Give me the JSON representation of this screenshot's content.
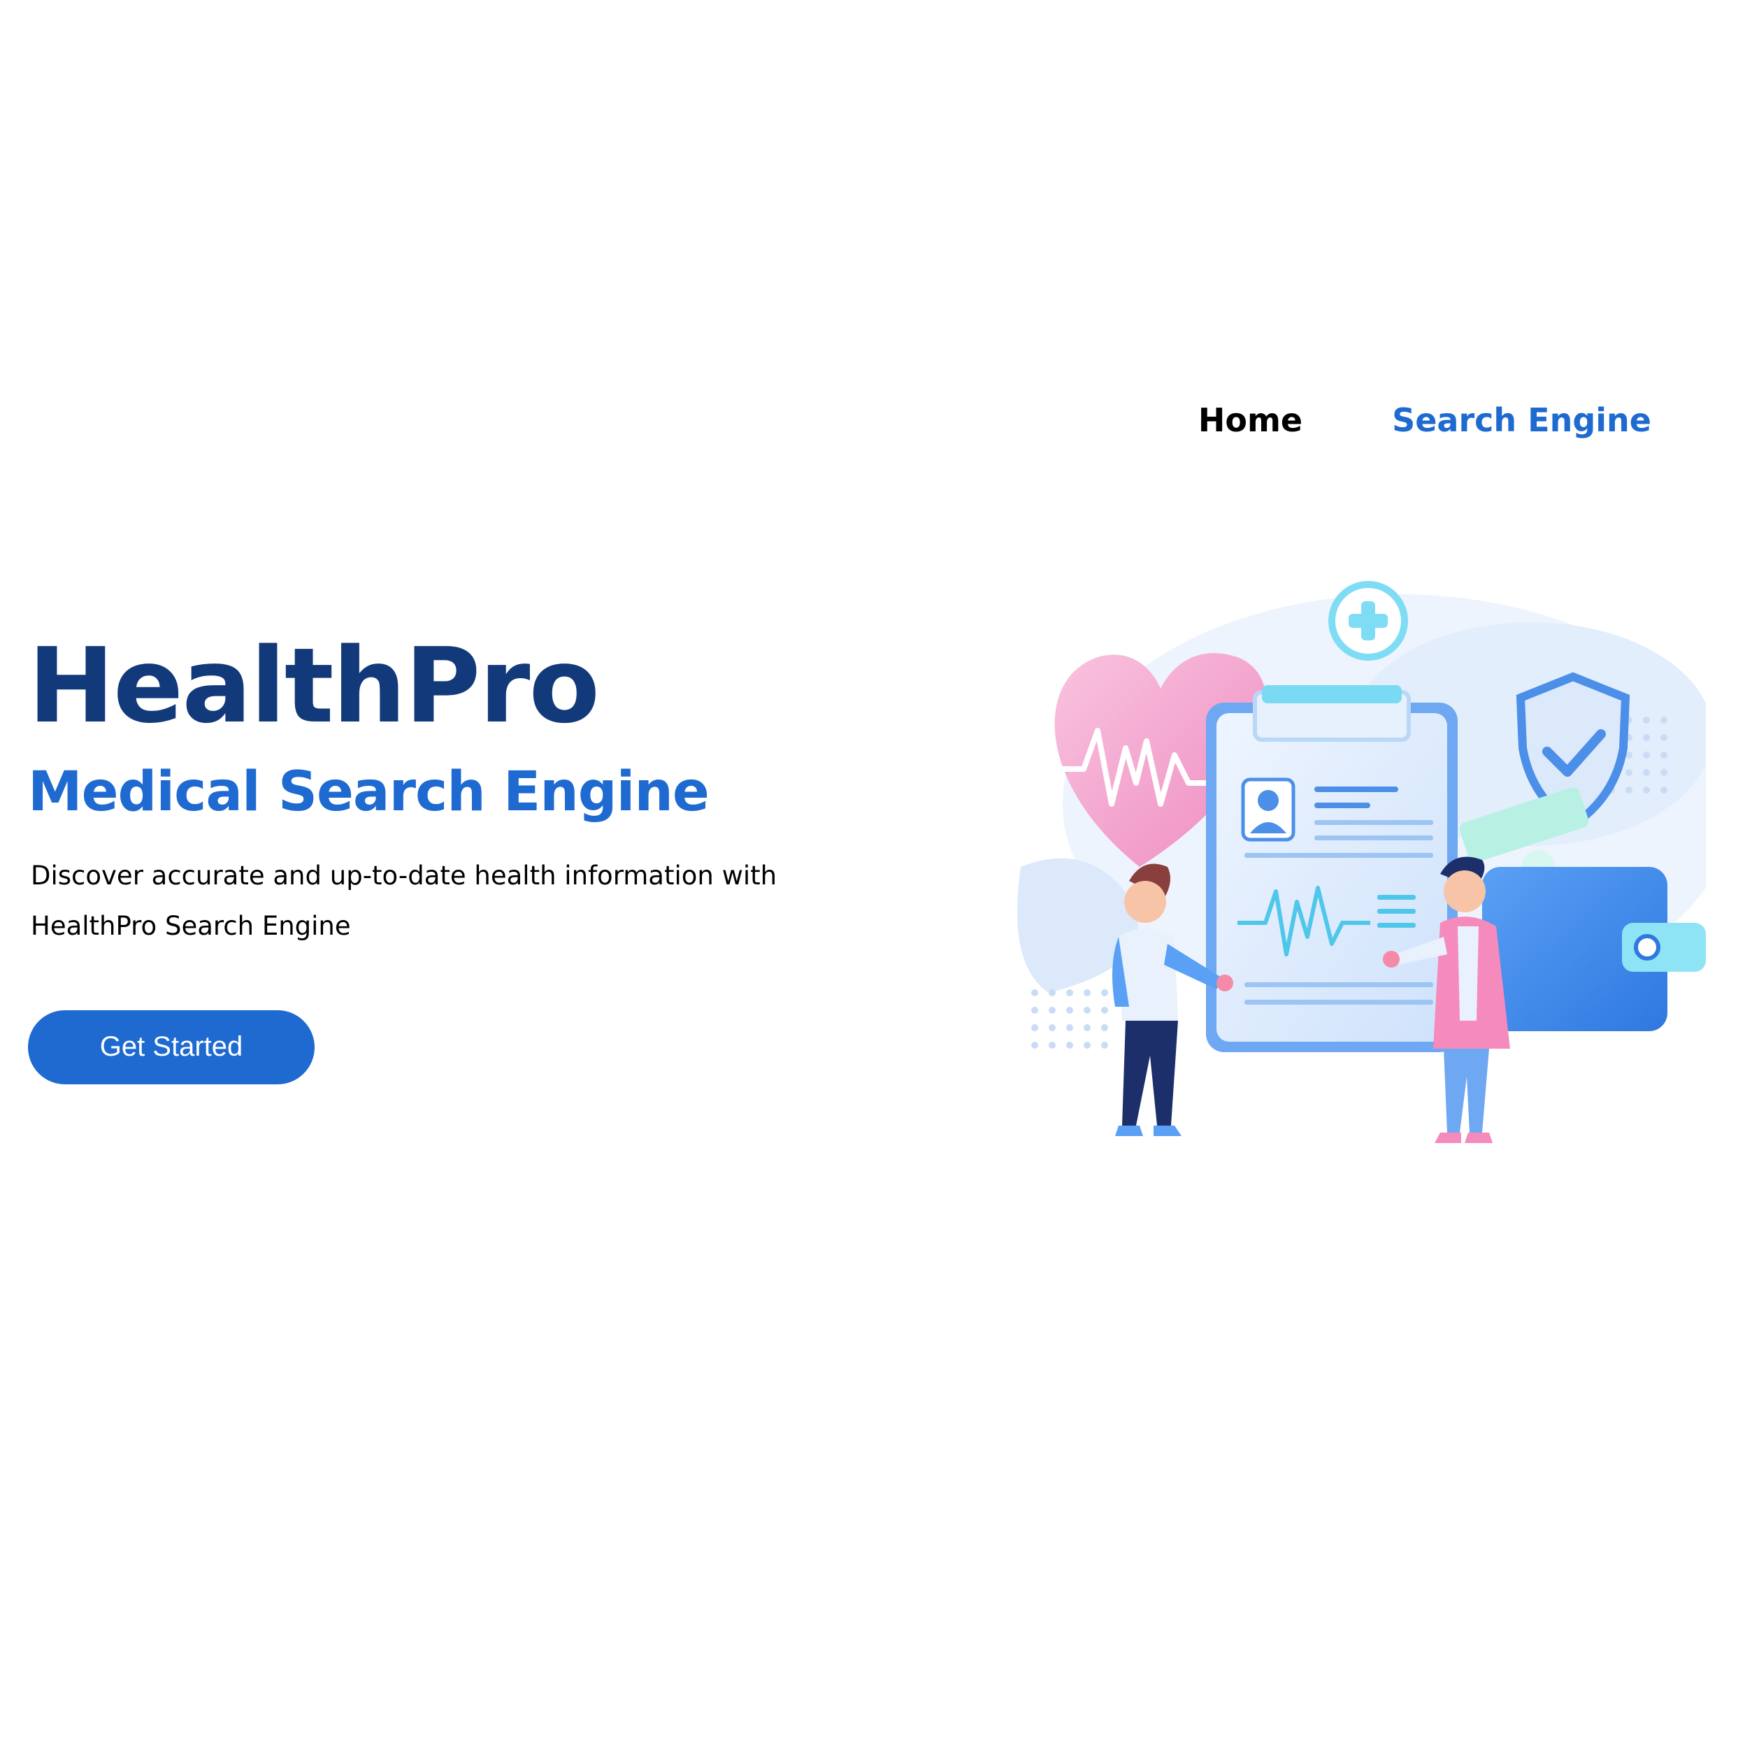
{
  "nav": {
    "home_label": "Home",
    "search_engine_label": "Search Engine"
  },
  "hero": {
    "title": "HealthPro",
    "subtitle": "Medical Search Engine",
    "description": "Discover accurate and up-to-date health information with HealthPro Search Engine",
    "cta_label": "Get Started"
  },
  "colors": {
    "brand_dark": "#123a7a",
    "brand_blue": "#1e6ad0",
    "heart_pink": "#f4a6cf",
    "light_blue": "#dbe9fb"
  },
  "illustration": {
    "icons": [
      "heart-icon",
      "clipboard-icon",
      "shield-check-icon",
      "plus-circle-icon",
      "wallet-icon",
      "heartbeat-icon",
      "person-icon"
    ]
  }
}
